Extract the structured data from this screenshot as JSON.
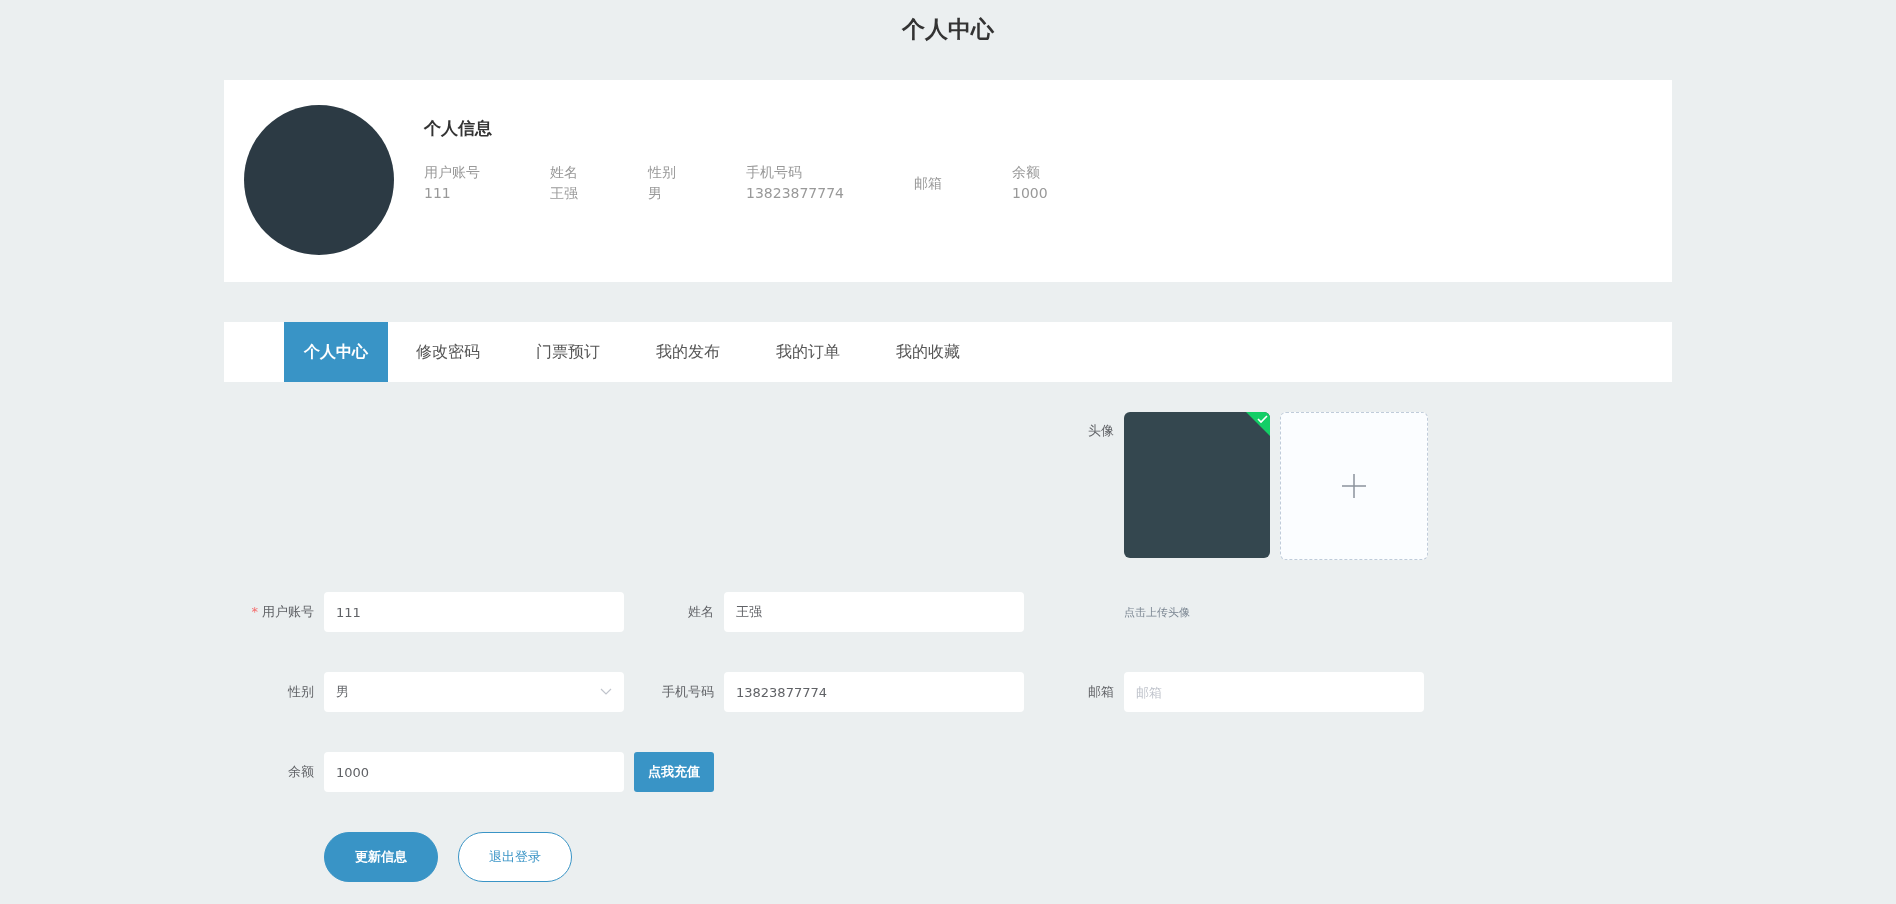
{
  "page_title": "个人中心",
  "profile": {
    "heading": "个人信息",
    "fields": [
      {
        "label": "用户账号",
        "value": "111"
      },
      {
        "label": "姓名",
        "value": "王强"
      },
      {
        "label": "性别",
        "value": "男"
      },
      {
        "label": "手机号码",
        "value": "13823877774"
      },
      {
        "label": "邮箱"
      },
      {
        "label": "余额",
        "value": "1000"
      }
    ]
  },
  "tabs": [
    {
      "label": "个人中心",
      "selected": true
    },
    {
      "label": "修改密码",
      "selected": false
    },
    {
      "label": "门票预订",
      "selected": false
    },
    {
      "label": "我的发布",
      "selected": false
    },
    {
      "label": "我的订单",
      "selected": false
    },
    {
      "label": "我的收藏",
      "selected": false
    }
  ],
  "form": {
    "rows": [
      [
        {
          "kind": "upload",
          "label": "头像",
          "uploaded": true
        }
      ],
      [
        {
          "kind": "text",
          "label": "用户账号",
          "value": "111",
          "required_mark": "*"
        },
        {
          "kind": "text",
          "label": "姓名",
          "value": "王强"
        },
        {
          "kind": "hint",
          "text": "点击上传头像"
        }
      ],
      [
        {
          "kind": "select",
          "label": "性别",
          "value": "男"
        },
        {
          "kind": "text",
          "label": "手机号码",
          "value": "13823877774"
        },
        {
          "kind": "text",
          "label": "邮箱",
          "placeholder": "邮箱"
        }
      ],
      [
        {
          "kind": "text",
          "label": "余额",
          "value": "1000",
          "action": "点我充值"
        }
      ],
      [
        {
          "kind": "buttons",
          "buttons": [
            {
              "label": "更新信息",
              "kind": "primary"
            },
            {
              "label": "退出登录",
              "kind": "outline"
            }
          ]
        }
      ]
    ]
  }
}
